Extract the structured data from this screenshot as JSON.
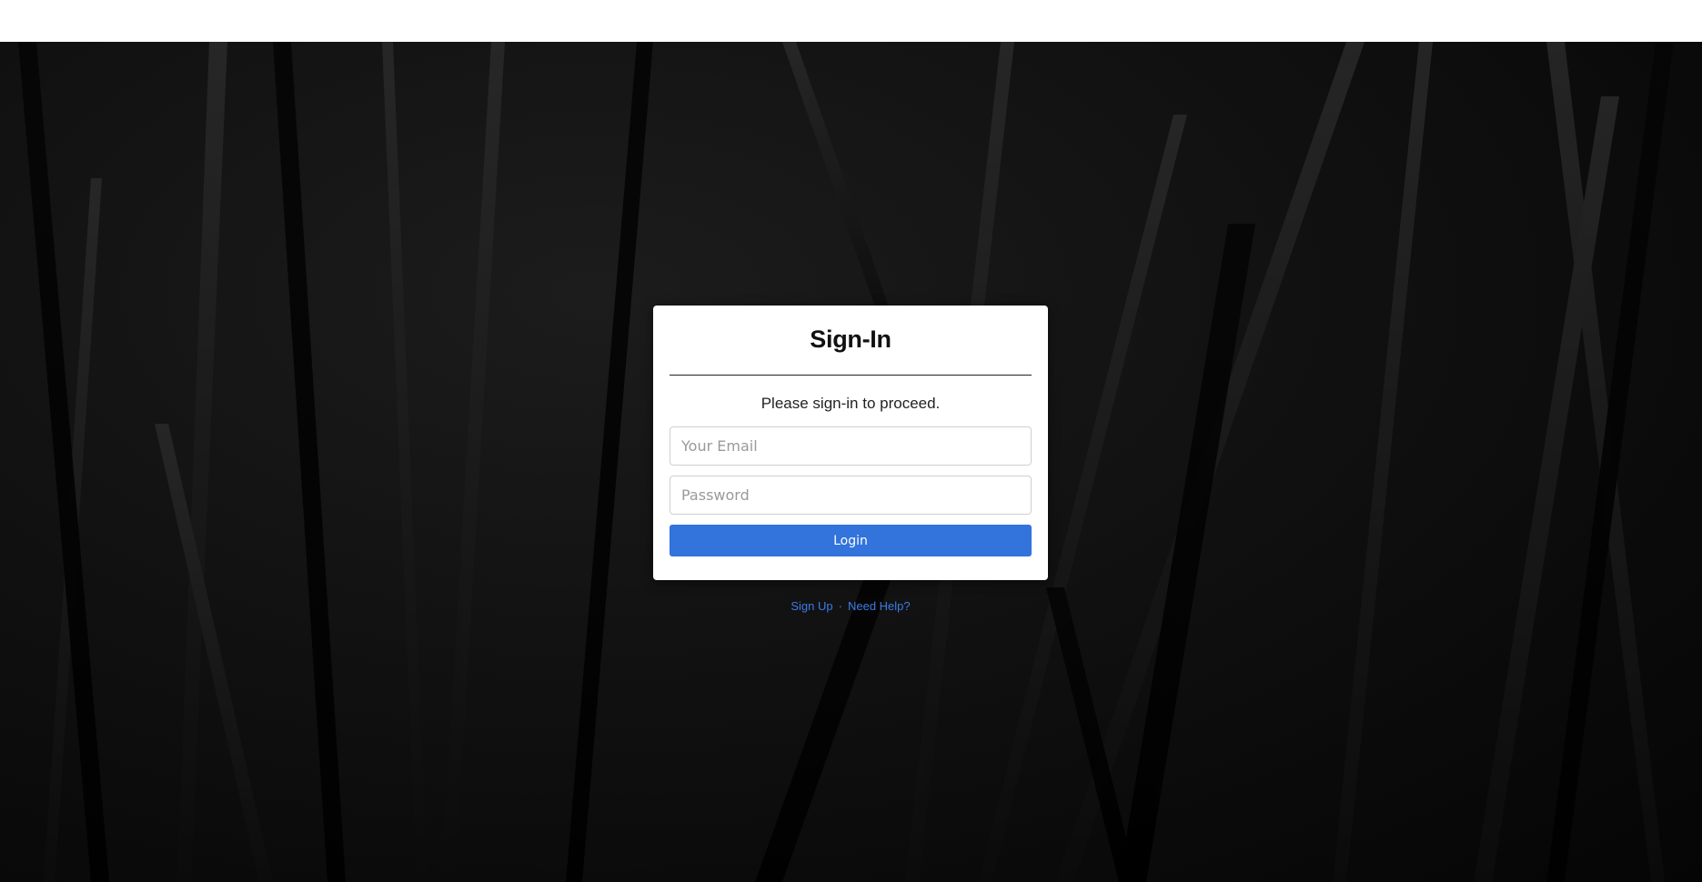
{
  "signin": {
    "title": "Sign-In",
    "subtitle": "Please sign-in to proceed.",
    "email_placeholder": "Your Email",
    "email_value": "",
    "password_placeholder": "Password",
    "password_value": "",
    "login_label": "Login"
  },
  "footer_links": {
    "signup_label": "Sign Up",
    "separator": "·",
    "help_label": "Need Help?"
  },
  "colors": {
    "accent": "#3273dc",
    "link": "#3e7be6",
    "top_bar": "#ffffff",
    "background": "#111111"
  }
}
